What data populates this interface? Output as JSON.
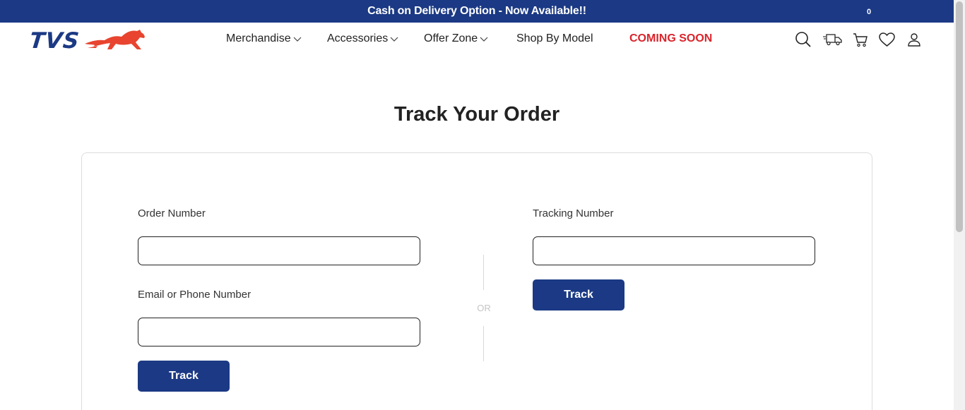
{
  "announcement": "Cash on Delivery Option - Now Available!!",
  "brand": {
    "logo_text": "TVS",
    "logo_color": "#1b3984",
    "horse_color": "#e8442f"
  },
  "nav": {
    "merchandise": "Merchandise",
    "accessories": "Accessories",
    "offer_zone": "Offer Zone",
    "shop_by_model": "Shop By Model",
    "coming_soon": "COMING SOON"
  },
  "header_icons": [
    "search-icon",
    "truck-icon",
    "cart-icon",
    "heart-icon",
    "user-icon"
  ],
  "cart_count": "0",
  "page_title": "Track Your Order",
  "form": {
    "order_number_label": "Order Number",
    "order_number_value": "",
    "email_phone_label": "Email or Phone Number",
    "email_phone_value": "",
    "track_label_left": "Track",
    "or_label": "OR",
    "tracking_number_label": "Tracking Number",
    "tracking_number_value": "",
    "track_label_right": "Track"
  },
  "colors": {
    "primary": "#1b3984",
    "accent_red": "#d9242b"
  }
}
